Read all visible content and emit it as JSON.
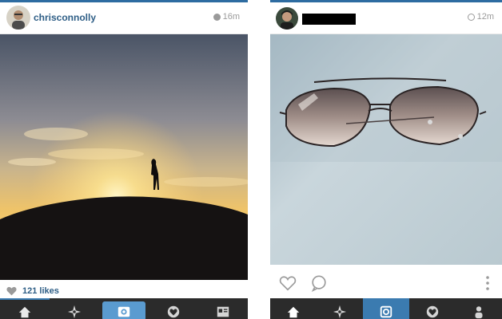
{
  "left_post": {
    "username": "chrisconnolly",
    "time": "16m",
    "likes": "121 likes"
  },
  "right_post": {
    "username": "[redacted]",
    "time": "12m"
  },
  "tabs": [
    "home-icon",
    "explore-icon",
    "camera-icon",
    "activity-icon",
    "profile-icon"
  ],
  "colors": {
    "accent": "#2e6ca1",
    "username": "#2e5e86",
    "tabbar": "#2b2b2b",
    "active_tab": "#3b7bb0"
  }
}
